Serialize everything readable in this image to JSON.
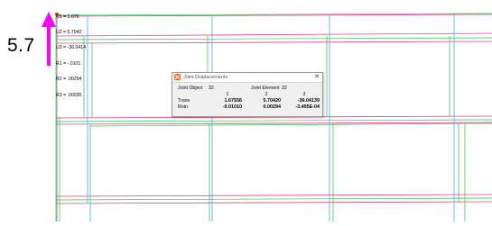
{
  "readout": {
    "lines": [
      "U1 = 1.676",
      "U2 = 5.7042",
      "U3 = -36.0414",
      "R1 = -.0101",
      "R2 = .00294",
      "R3 = .00035"
    ]
  },
  "annotation": {
    "value_text": "5.7",
    "arrow_color": "#ff00ff"
  },
  "dialog": {
    "title": "Joint Displacements",
    "close_label": "✕",
    "joint_object_label": "Joint Object",
    "joint_object_value": "32",
    "joint_element_label": "Joint Element",
    "joint_element_value": "32",
    "columns": [
      "1",
      "2",
      "3"
    ],
    "rows": [
      {
        "label": "Trans",
        "values": [
          "1.67556",
          "5.70420",
          "-36.04139"
        ]
      },
      {
        "label": "Rotn",
        "values": [
          "-0.01010",
          "0.00294",
          "-3.495E-04"
        ]
      }
    ]
  },
  "colors": {
    "beam_pink": "#e0408a",
    "grid_green": "#2cc24a",
    "grid_cyan": "#3ab8d8",
    "dark_line": "#555555"
  }
}
